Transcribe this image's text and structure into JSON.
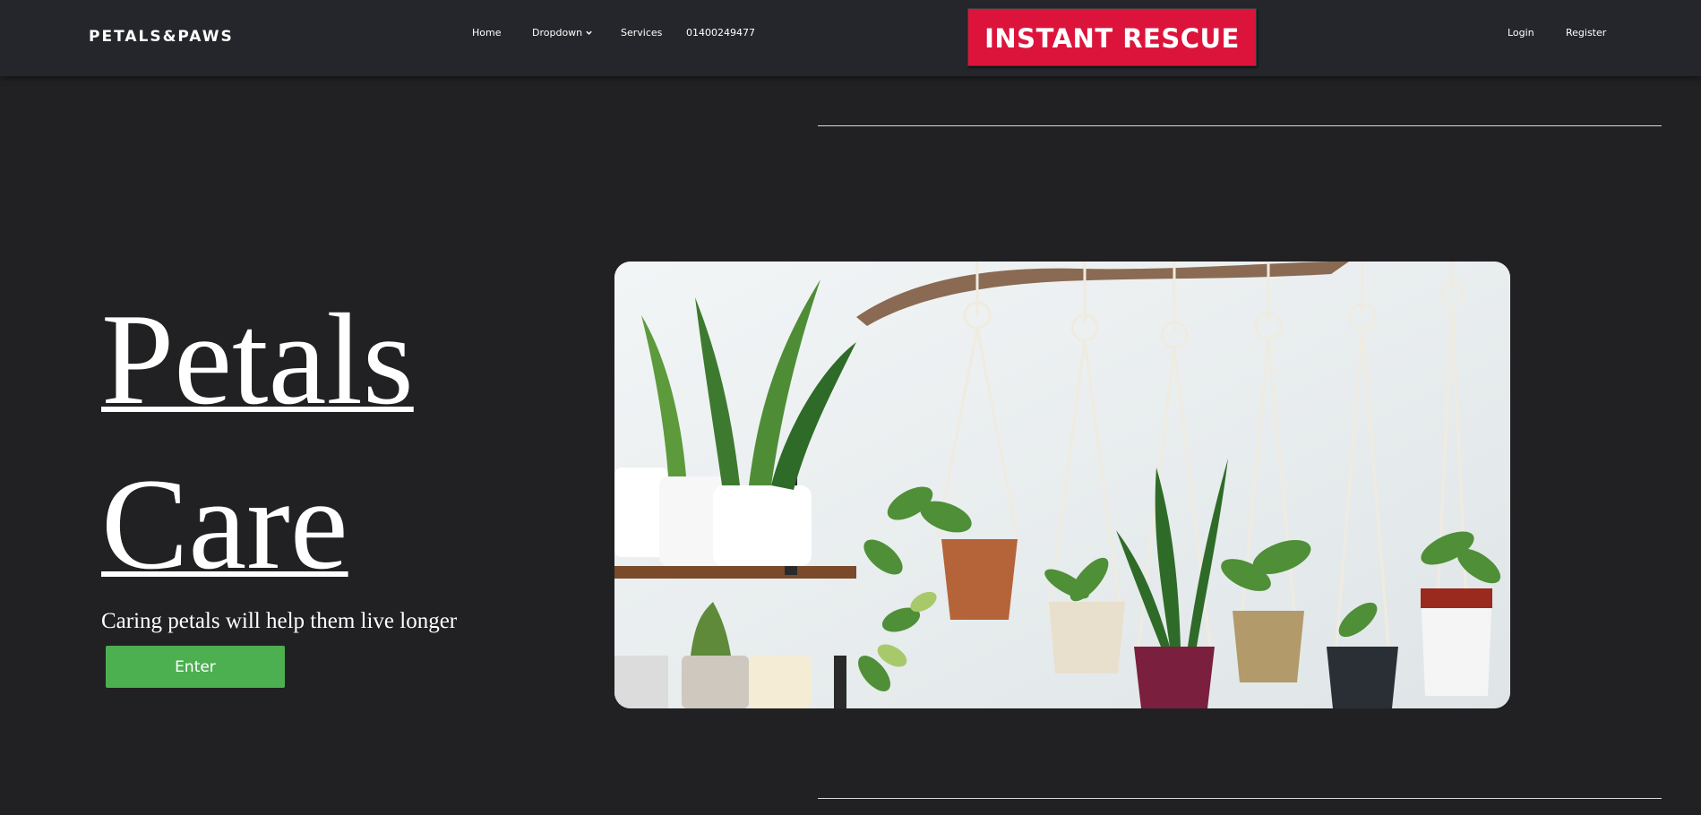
{
  "navbar": {
    "brand": "PETALS&PAWS",
    "links": {
      "home": "Home",
      "dropdown": "Dropdown",
      "services": "Services",
      "phone": "01400249477",
      "login": "Login",
      "register": "Register"
    },
    "rescue_button": "INSTANT RESCUE"
  },
  "hero": {
    "title_line1": "Petals",
    "title_line2": "Care",
    "tagline": "Caring petals will help them live longer",
    "enter_button": "Enter",
    "image": {
      "subject": "hanging macrame plant holders with potted plants and a wall shelf"
    }
  },
  "colors": {
    "page_background": "#212123",
    "navbar_background": "#25262b",
    "rescue_button": "#dc143c",
    "enter_button": "#4caf50",
    "text": "#ffffff"
  },
  "icons": {
    "dropdown_chevron": "chevron-down-icon"
  }
}
